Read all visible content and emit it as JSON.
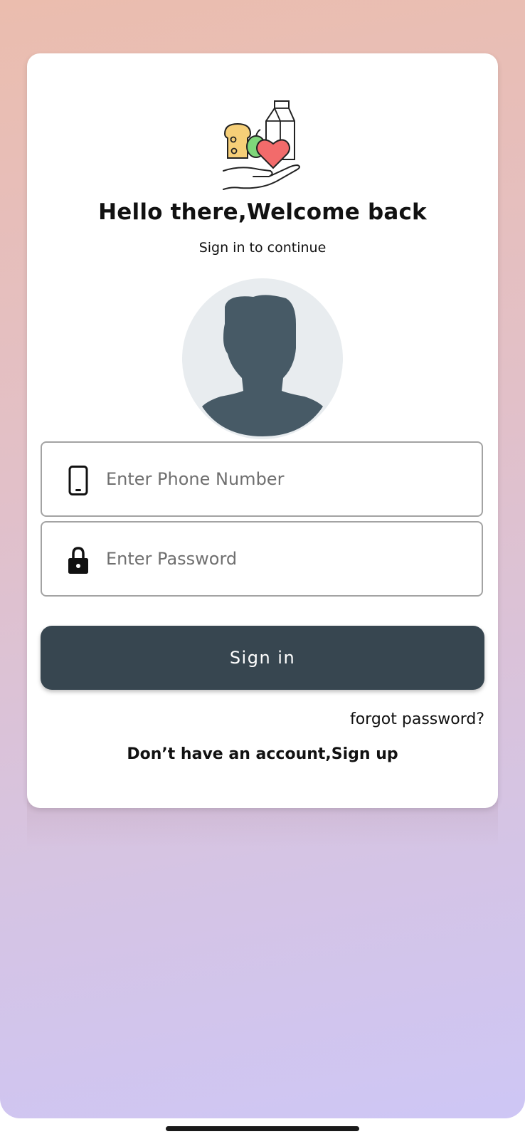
{
  "header": {
    "title": "Hello there,Welcome back",
    "subtitle": "Sign in to continue"
  },
  "logo": {
    "icon": "grocery-donation-icon"
  },
  "avatar": {
    "icon": "user-silhouette-icon"
  },
  "form": {
    "phone": {
      "icon": "phone-icon",
      "placeholder": "Enter Phone Number",
      "value": ""
    },
    "password": {
      "icon": "lock-icon",
      "placeholder": "Enter Password",
      "value": ""
    },
    "signin_label": "Sign in",
    "forgot_label": "forgot password?",
    "signup_label": "Don’t have an account,Sign up"
  },
  "colors": {
    "button": "#374650",
    "avatar_fg": "#475a66",
    "avatar_bg": "#e8ecef",
    "heart": "#f26b6b",
    "apple": "#7fd67a",
    "bread": "#f6cf78"
  }
}
